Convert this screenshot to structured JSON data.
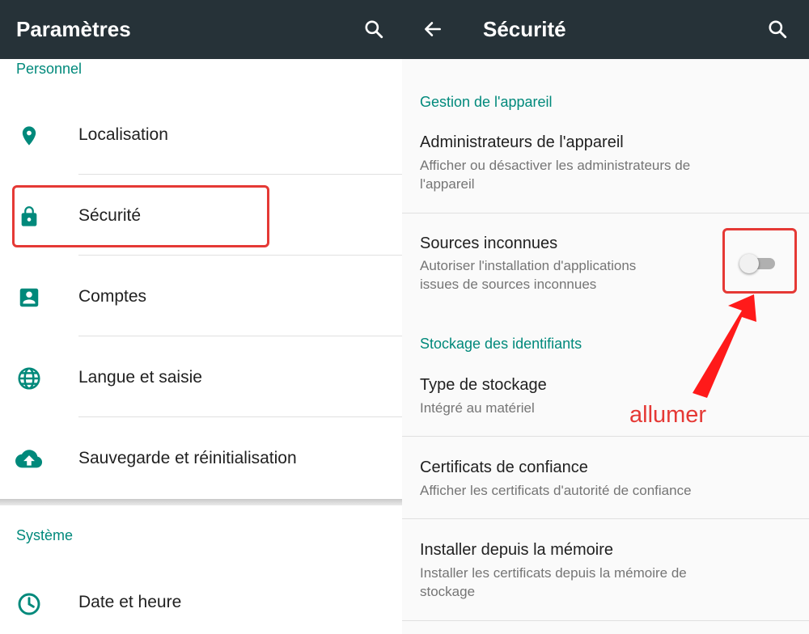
{
  "left_panel": {
    "appbar": {
      "title": "Paramètres",
      "search_icon": "search-icon"
    },
    "section_personal": "Personnel",
    "items": [
      {
        "label": "Localisation",
        "icon": "location-pin-icon"
      },
      {
        "label": "Sécurité",
        "icon": "lock-icon"
      },
      {
        "label": "Comptes",
        "icon": "account-box-icon"
      },
      {
        "label": "Langue et saisie",
        "icon": "globe-icon"
      },
      {
        "label": "Sauvegarde et réinitialisation",
        "icon": "cloud-upload-icon"
      }
    ],
    "section_system": "Système",
    "system_items": [
      {
        "label": "Date et heure",
        "icon": "clock-icon"
      }
    ]
  },
  "right_panel": {
    "appbar": {
      "title": "Sécurité",
      "back_icon": "arrow-back-icon",
      "search_icon": "search-icon"
    },
    "section_device_admin": "Gestion de l'appareil",
    "device_admins": {
      "title": "Administrateurs de l'appareil",
      "subtitle_line1": "Afficher ou désactiver les administrateurs de",
      "subtitle_line2": "l'appareil"
    },
    "unknown_sources": {
      "title": "Sources inconnues",
      "subtitle_line1": "Autoriser l'installation d'applications",
      "subtitle_line2": "issues de sources inconnues",
      "toggle_on": false
    },
    "section_credentials": "Stockage des identifiants",
    "storage_type": {
      "title": "Type de stockage",
      "subtitle": "Intégré au matériel"
    },
    "trusted_certs": {
      "title": "Certificats de confiance",
      "subtitle": "Afficher les certificats d'autorité de confiance"
    },
    "install_from_storage": {
      "title": "Installer depuis la mémoire",
      "subtitle_line1": "Installer les certificats depuis la mémoire de",
      "subtitle_line2": "stockage"
    }
  },
  "annotation": {
    "text": "allumer"
  },
  "colors": {
    "appbar": "#263238",
    "accent": "#00897b",
    "highlight": "#e53935"
  }
}
